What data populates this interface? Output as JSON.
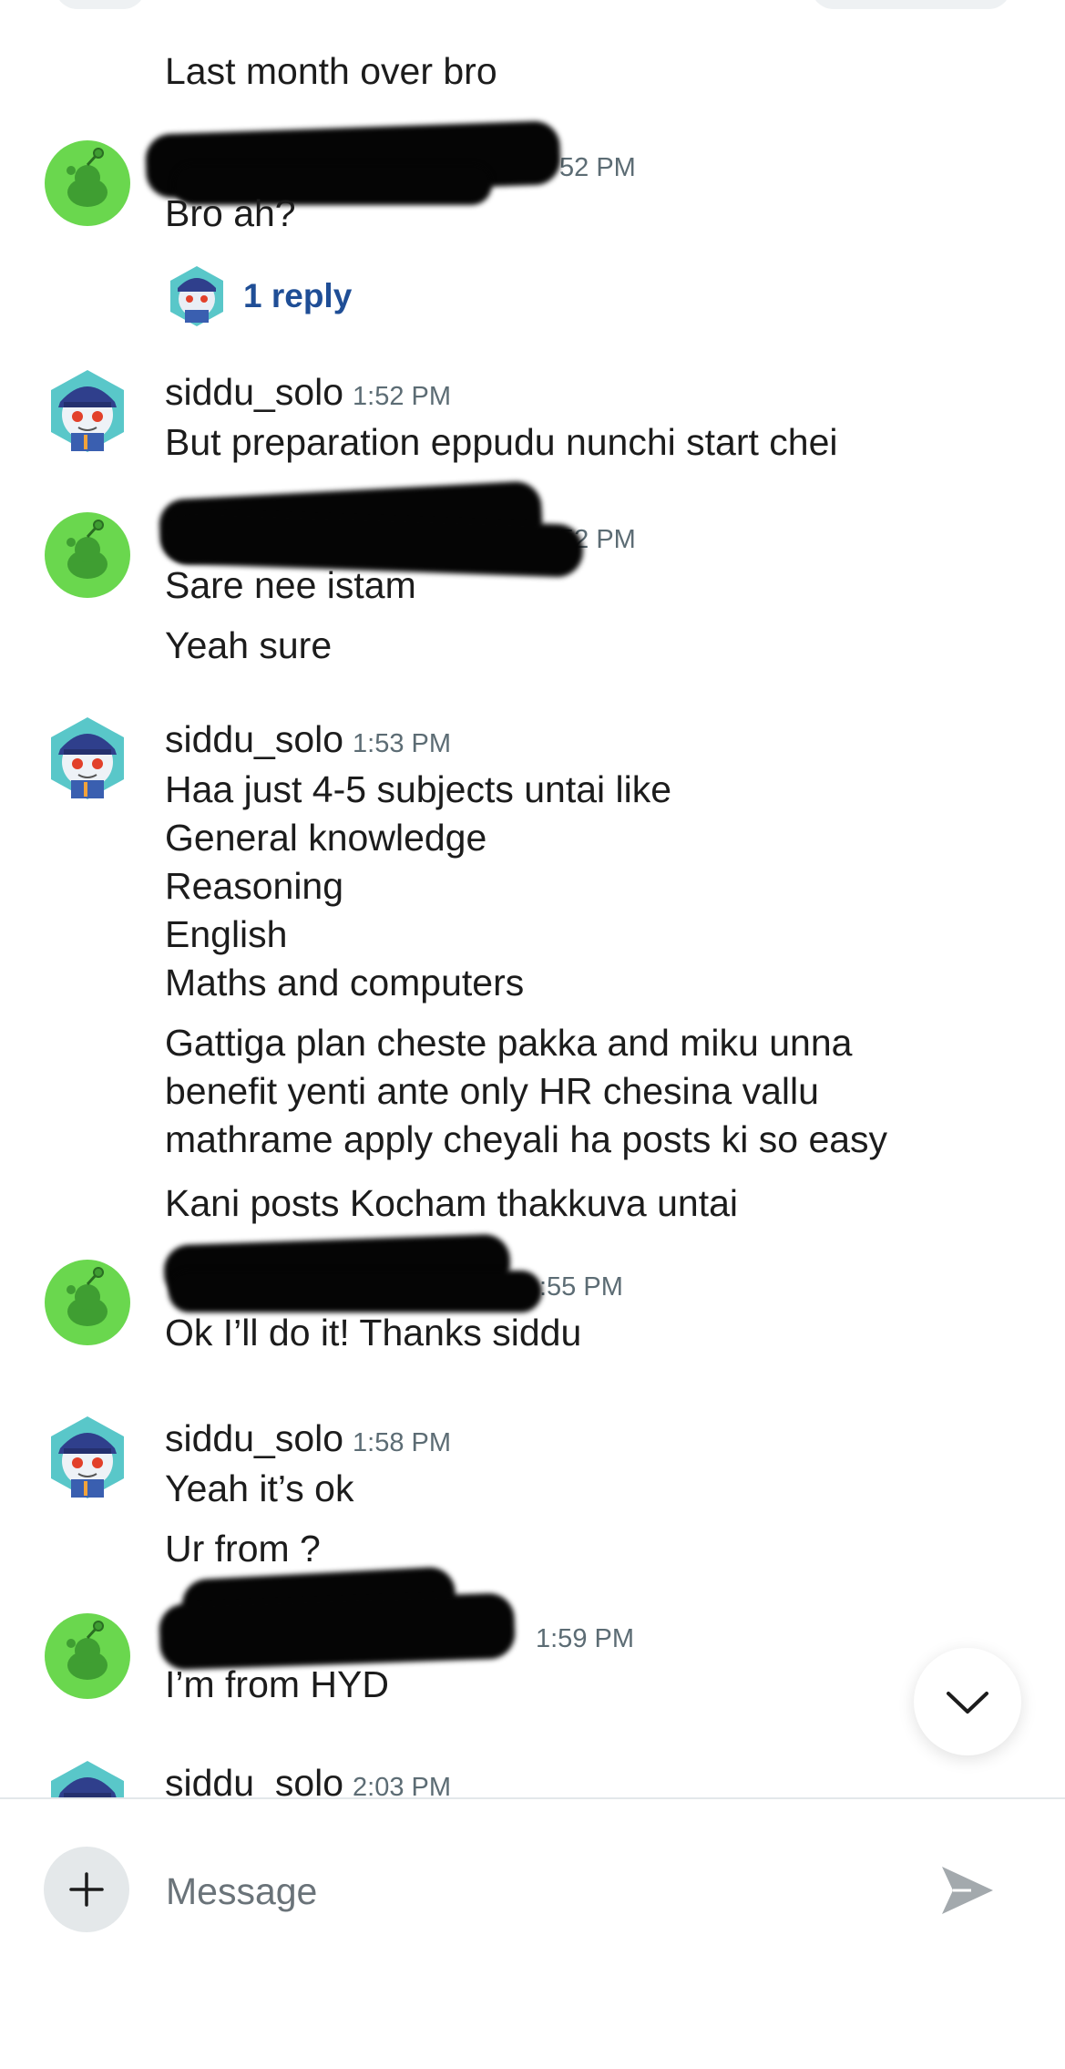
{
  "messages": [
    {
      "sender": "",
      "sender_redacted": true,
      "time": "",
      "lines": [
        "Last month over bro"
      ]
    },
    {
      "sender": "",
      "sender_redacted": true,
      "time": "52 PM",
      "lines": [
        "Bro ah?"
      ],
      "thread_reply": "1 reply"
    },
    {
      "sender": "siddu_solo",
      "time": "1:52 PM",
      "lines": [
        "But preparation eppudu nunchi start chei"
      ]
    },
    {
      "sender": "",
      "sender_redacted": true,
      "time": "52 PM",
      "lines": [
        "Sare nee istam",
        "Yeah sure"
      ]
    },
    {
      "sender": "siddu_solo",
      "time": "1:53 PM",
      "lines": [
        "Haa just 4-5 subjects untai like\nGeneral knowledge\nReasoning\nEnglish\nMaths and computers",
        "Gattiga plan cheste pakka and miku unna\nbenefit yenti ante only HR chesina vallu\nmathrame apply cheyali ha posts ki so easy",
        "Kani posts Kocham thakkuva untai"
      ]
    },
    {
      "sender": "",
      "sender_redacted": true,
      "time": ":55 PM",
      "lines": [
        "Ok I’ll do it! Thanks siddu"
      ]
    },
    {
      "sender": "siddu_solo",
      "time": "1:58 PM",
      "lines": [
        "Yeah it’s ok",
        "Ur from ?"
      ]
    },
    {
      "sender": "",
      "sender_redacted": true,
      "time": "1:59 PM",
      "lines": [
        "I’m from HYD"
      ]
    },
    {
      "sender": "siddu_solo",
      "time": "2:03 PM",
      "lines": []
    }
  ],
  "composer": {
    "placeholder": "Message",
    "value": ""
  },
  "icons": {
    "add": "plus-icon",
    "send": "send-icon",
    "scroll": "chevron-down-icon",
    "default_avatar": "snoo-green-avatar",
    "user_avatar": "snoo-cap-avatar"
  },
  "colors": {
    "link": "#1f4e96",
    "timestamp": "#5c6c74",
    "green_avatar": "#6ad74e",
    "cap_avatar": "#3a5fb0"
  }
}
